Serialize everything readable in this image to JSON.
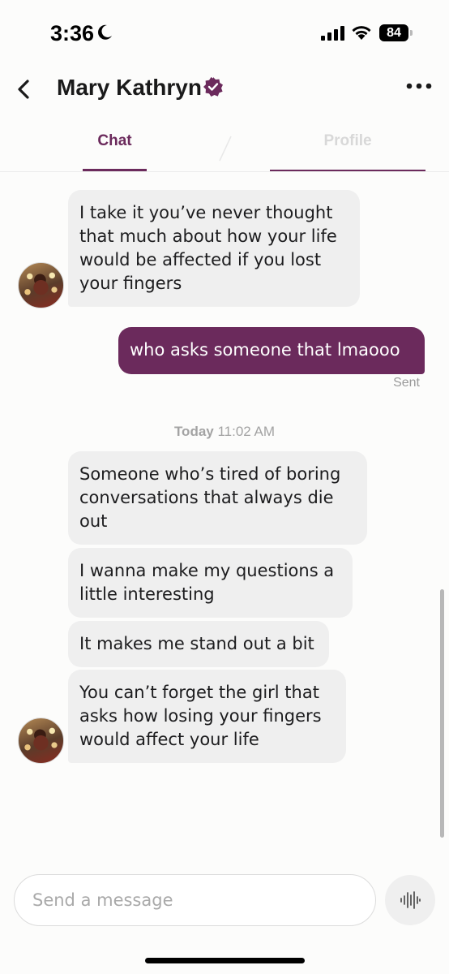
{
  "status_bar": {
    "time": "3:36",
    "battery": "84"
  },
  "header": {
    "contact_name": "Mary Kathryn"
  },
  "tabs": {
    "chat": "Chat",
    "profile": "Profile"
  },
  "messages_before": [
    {
      "from": "them",
      "text": "I take it you’ve never thought that much about how your life would be affected if you lost your fingers"
    },
    {
      "from": "me",
      "text": "who asks someone that lmaooo"
    }
  ],
  "sent_label": "Sent",
  "date_divider": {
    "day": "Today",
    "time": "11:02 AM"
  },
  "messages_after": [
    {
      "from": "them",
      "text": "Someone who’s tired of boring conversations that always die out"
    },
    {
      "from": "them",
      "text": "I wanna make my questions a little interesting"
    },
    {
      "from": "them",
      "text": "It makes me stand out a bit"
    },
    {
      "from": "them",
      "text": "You can’t forget the girl that asks how losing your fingers would affect your life"
    }
  ],
  "composer": {
    "placeholder": "Send a message",
    "value": ""
  },
  "colors": {
    "accent": "#6b2a5c",
    "incoming_bubble": "#efefef",
    "outgoing_text": "#ffffff"
  },
  "icons": [
    "moon-icon",
    "cellular-signal-icon",
    "wifi-icon",
    "battery-icon",
    "back-chevron-icon",
    "verified-badge-icon",
    "more-options-icon",
    "voice-waveform-icon"
  ]
}
